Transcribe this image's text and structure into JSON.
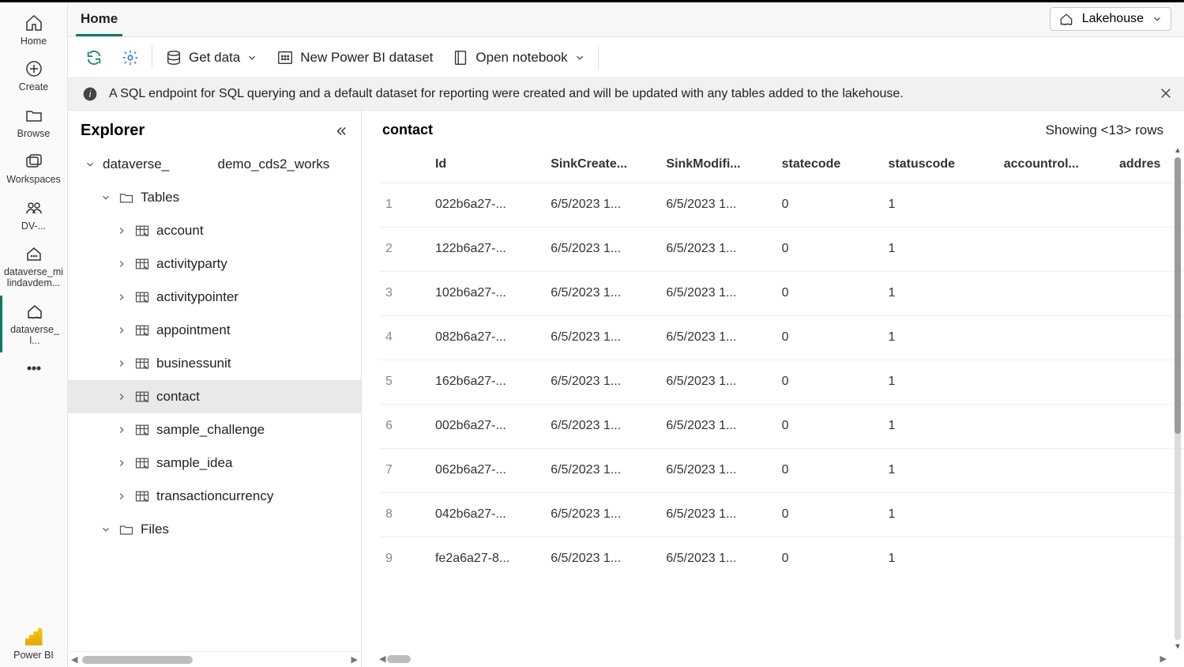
{
  "tab": "Home",
  "mode_switch": "Lakehouse",
  "toolbar": {
    "get_data": "Get data",
    "new_dataset": "New Power BI dataset",
    "open_notebook": "Open notebook"
  },
  "notice": "A SQL endpoint for SQL querying and a default dataset for reporting were created and will be updated with any tables added to the lakehouse.",
  "rail": {
    "home": "Home",
    "create": "Create",
    "browse": "Browse",
    "workspaces": "Workspaces",
    "ws1": "DV-...",
    "ws2": "dataverse_milindavdem...",
    "ws3": "dataverse_              l...",
    "powerbi": "Power BI"
  },
  "explorer": {
    "title": "Explorer",
    "lakehouse": "dataverse_             demo_cds2_works",
    "tables_label": "Tables",
    "files_label": "Files",
    "tables": [
      "account",
      "activityparty",
      "activitypointer",
      "appointment",
      "businessunit",
      "contact",
      "sample_challenge",
      "sample_idea",
      "transactioncurrency"
    ],
    "selected": "contact"
  },
  "grid": {
    "title": "contact",
    "row_count_display": "Showing  <13>  rows",
    "columns": [
      "Id",
      "SinkCreate...",
      "SinkModifi...",
      "statecode",
      "statuscode",
      "accountrol...",
      "addres"
    ],
    "rows": [
      {
        "n": "1",
        "id": "022b6a27-...",
        "c": "6/5/2023 1...",
        "m": "6/5/2023 1...",
        "st": "0",
        "sc": "1",
        "a": "",
        "ad": ""
      },
      {
        "n": "2",
        "id": "122b6a27-...",
        "c": "6/5/2023 1...",
        "m": "6/5/2023 1...",
        "st": "0",
        "sc": "1",
        "a": "",
        "ad": ""
      },
      {
        "n": "3",
        "id": "102b6a27-...",
        "c": "6/5/2023 1...",
        "m": "6/5/2023 1...",
        "st": "0",
        "sc": "1",
        "a": "",
        "ad": ""
      },
      {
        "n": "4",
        "id": "082b6a27-...",
        "c": "6/5/2023 1...",
        "m": "6/5/2023 1...",
        "st": "0",
        "sc": "1",
        "a": "",
        "ad": ""
      },
      {
        "n": "5",
        "id": "162b6a27-...",
        "c": "6/5/2023 1...",
        "m": "6/5/2023 1...",
        "st": "0",
        "sc": "1",
        "a": "",
        "ad": ""
      },
      {
        "n": "6",
        "id": "002b6a27-...",
        "c": "6/5/2023 1...",
        "m": "6/5/2023 1...",
        "st": "0",
        "sc": "1",
        "a": "",
        "ad": ""
      },
      {
        "n": "7",
        "id": "062b6a27-...",
        "c": "6/5/2023 1...",
        "m": "6/5/2023 1...",
        "st": "0",
        "sc": "1",
        "a": "",
        "ad": ""
      },
      {
        "n": "8",
        "id": "042b6a27-...",
        "c": "6/5/2023 1...",
        "m": "6/5/2023 1...",
        "st": "0",
        "sc": "1",
        "a": "",
        "ad": ""
      },
      {
        "n": "9",
        "id": "fe2a6a27-8...",
        "c": "6/5/2023 1...",
        "m": "6/5/2023 1...",
        "st": "0",
        "sc": "1",
        "a": "",
        "ad": ""
      }
    ]
  }
}
